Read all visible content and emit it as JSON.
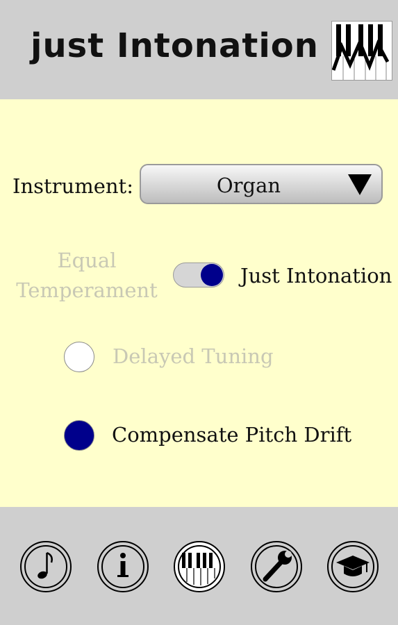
{
  "header": {
    "title": "just Intonation",
    "logo_icon": "piano-keys-logo-icon"
  },
  "settings": {
    "instrument_label": "Instrument:",
    "instrument_value": "Organ",
    "mode_left_line1": "Equal",
    "mode_left_line2": "Temperament",
    "mode_right": "Just Intonation",
    "mode_toggle_on": true,
    "delayed_tuning_label": "Delayed Tuning",
    "delayed_tuning_checked": false,
    "compensate_label": "Compensate Pitch Drift",
    "compensate_checked": true
  },
  "colors": {
    "accent": "#00008b",
    "content_bg": "#ffffcc",
    "bar_bg": "#cfcfcf",
    "disabled_text": "#c8c8b4"
  },
  "footer": {
    "buttons": [
      {
        "icon": "music-note-icon"
      },
      {
        "icon": "info-icon"
      },
      {
        "icon": "piano-keyboard-icon"
      },
      {
        "icon": "wrench-icon"
      },
      {
        "icon": "graduation-cap-icon"
      }
    ]
  }
}
